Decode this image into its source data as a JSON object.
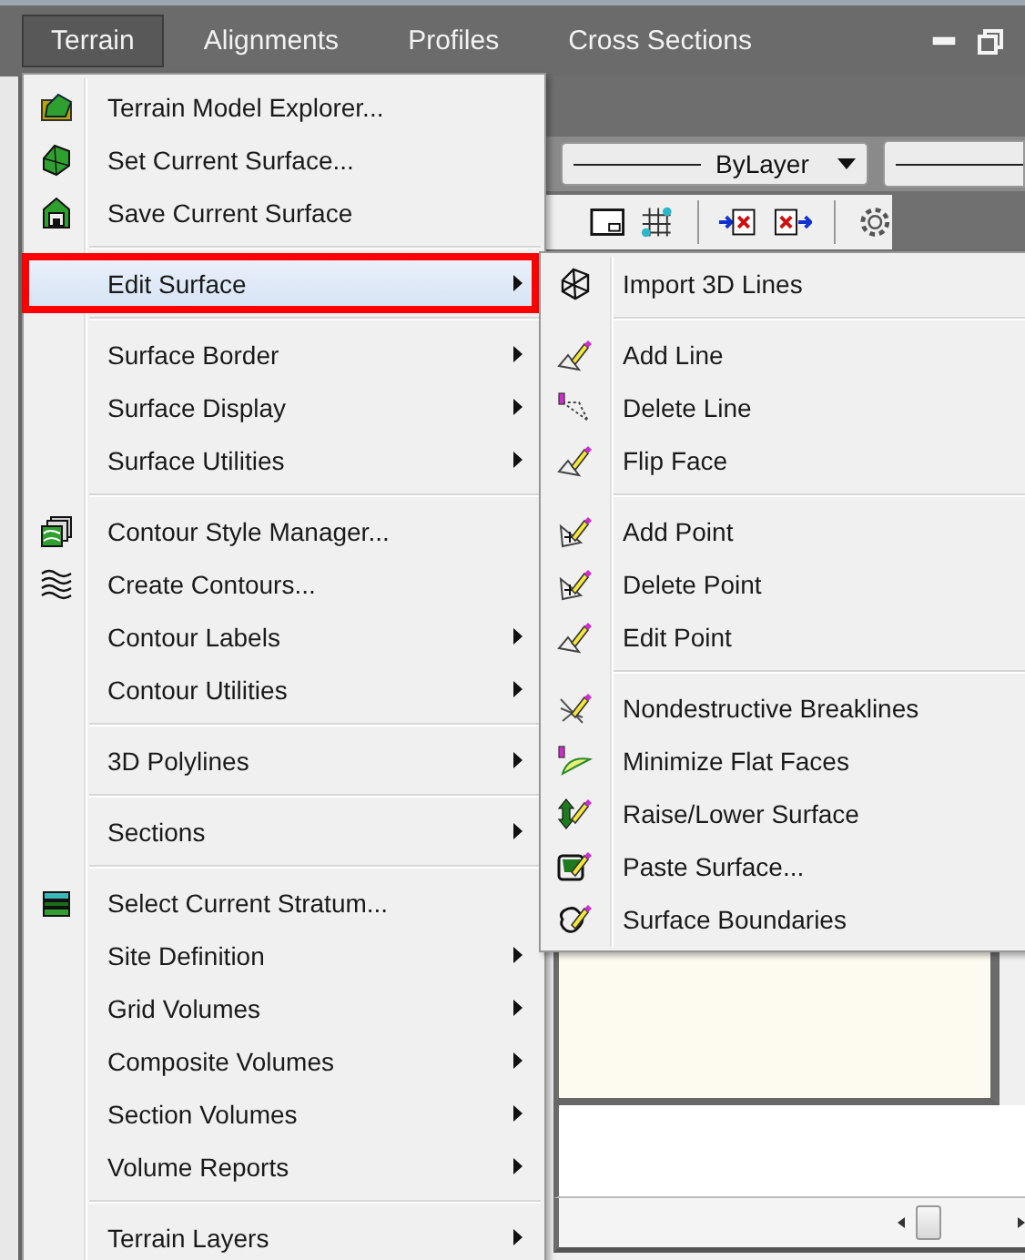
{
  "menu_bar": {
    "items": [
      {
        "label": "Terrain",
        "selected": true
      },
      {
        "label": "Alignments",
        "selected": false
      },
      {
        "label": "Profiles",
        "selected": false
      },
      {
        "label": "Cross Sections",
        "selected": false
      }
    ]
  },
  "toolbar": {
    "linetype_combo": {
      "value": "ByLayer"
    }
  },
  "menu": {
    "groups": [
      [
        {
          "label": "Terrain Model Explorer...",
          "submenu": false,
          "selected": false,
          "annotated": false
        },
        {
          "label": "Set Current Surface...",
          "submenu": false,
          "selected": false,
          "annotated": false
        },
        {
          "label": "Save Current Surface",
          "submenu": false,
          "selected": false,
          "annotated": false
        }
      ],
      [
        {
          "label": "Edit Surface",
          "submenu": true,
          "selected": true,
          "annotated": true
        }
      ],
      [
        {
          "label": "Surface Border",
          "submenu": true,
          "selected": false,
          "annotated": false
        },
        {
          "label": "Surface Display",
          "submenu": true,
          "selected": false,
          "annotated": false
        },
        {
          "label": "Surface Utilities",
          "submenu": true,
          "selected": false,
          "annotated": false
        }
      ],
      [
        {
          "label": "Contour Style Manager...",
          "submenu": false,
          "selected": false,
          "annotated": false
        },
        {
          "label": "Create Contours...",
          "submenu": false,
          "selected": false,
          "annotated": false
        },
        {
          "label": "Contour Labels",
          "submenu": true,
          "selected": false,
          "annotated": false
        },
        {
          "label": "Contour Utilities",
          "submenu": true,
          "selected": false,
          "annotated": false
        }
      ],
      [
        {
          "label": "3D Polylines",
          "submenu": true,
          "selected": false,
          "annotated": false
        }
      ],
      [
        {
          "label": "Sections",
          "submenu": true,
          "selected": false,
          "annotated": false
        }
      ],
      [
        {
          "label": "Select Current Stratum...",
          "submenu": false,
          "selected": false,
          "annotated": false
        },
        {
          "label": "Site Definition",
          "submenu": true,
          "selected": false,
          "annotated": false
        },
        {
          "label": "Grid Volumes",
          "submenu": true,
          "selected": false,
          "annotated": false
        },
        {
          "label": "Composite Volumes",
          "submenu": true,
          "selected": false,
          "annotated": false
        },
        {
          "label": "Section Volumes",
          "submenu": true,
          "selected": false,
          "annotated": false
        },
        {
          "label": "Volume Reports",
          "submenu": true,
          "selected": false,
          "annotated": false
        }
      ],
      [
        {
          "label": "Terrain Layers",
          "submenu": true,
          "selected": false,
          "annotated": false
        }
      ]
    ]
  },
  "submenu": {
    "groups": [
      [
        {
          "label": "Import 3D Lines"
        }
      ],
      [
        {
          "label": "Add Line"
        },
        {
          "label": "Delete Line"
        },
        {
          "label": "Flip Face"
        }
      ],
      [
        {
          "label": "Add Point"
        },
        {
          "label": "Delete Point"
        },
        {
          "label": "Edit Point"
        }
      ],
      [
        {
          "label": "Nondestructive Breaklines"
        },
        {
          "label": "Minimize Flat Faces"
        },
        {
          "label": "Raise/Lower Surface"
        },
        {
          "label": "Paste Surface..."
        },
        {
          "label": "Surface Boundaries"
        }
      ]
    ]
  }
}
